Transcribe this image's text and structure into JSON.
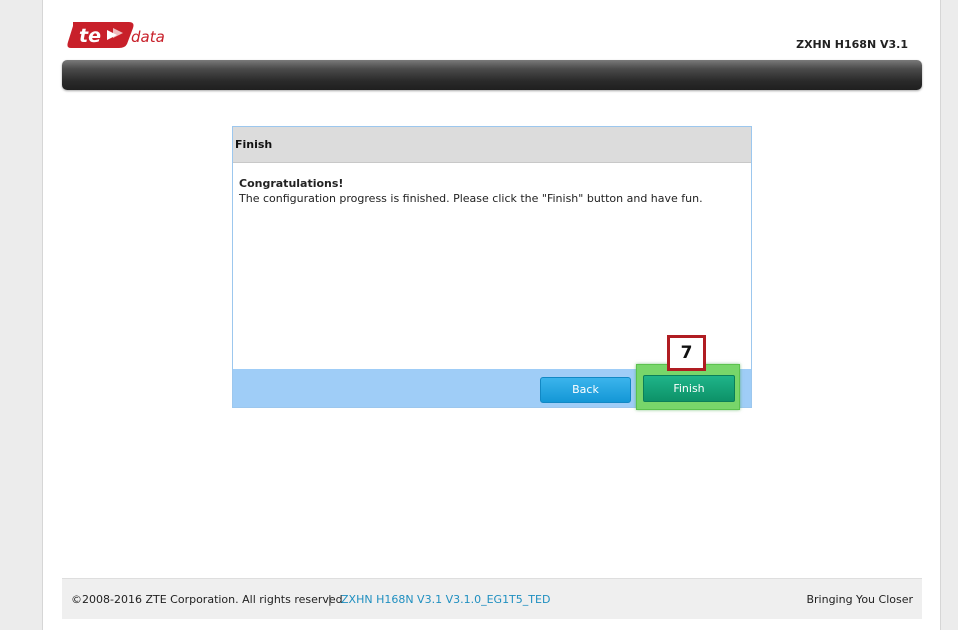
{
  "header": {
    "logo_text": "te data",
    "logo_suffix": "data",
    "model": "ZXHN H168N V3.1"
  },
  "panel": {
    "title": "Finish",
    "congrats": "Congratulations!",
    "message": "The configuration progress is finished. Please click the \"Finish\" button and have fun.",
    "back_label": "Back",
    "finish_label": "Finish"
  },
  "annotation": {
    "step_number": "7"
  },
  "footer": {
    "copyright": "©2008-2016 ZTE Corporation. All rights reserved",
    "separator": "|",
    "version": "ZXHN H168N V3.1 V3.1.0_EG1T5_TED",
    "slogan": "Bringing You Closer"
  },
  "colors": {
    "brand_red": "#c8202a",
    "back_button": "#1497d6",
    "finish_button": "#0d9268",
    "highlight": "#78d66a",
    "footer_link": "#1f8fc0"
  }
}
